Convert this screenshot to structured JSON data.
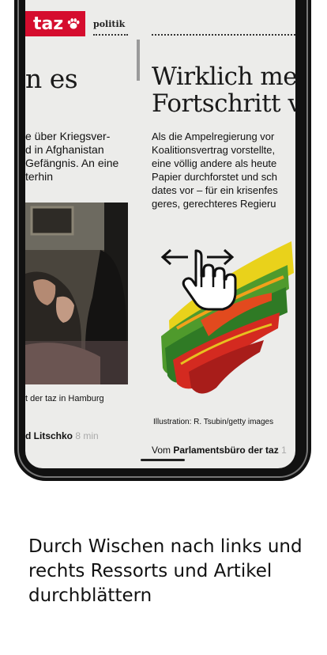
{
  "header": {
    "logo_text": "taz",
    "ressort": "politik",
    "brand_color": "#d50d2e"
  },
  "left_article": {
    "headline": "n es",
    "teaser_lines": [
      "e über Kriegsver-",
      "d in Afghanistan",
      "Gefängnis. An eine",
      "terhin"
    ],
    "photo_caption": "t der taz in Hamburg",
    "author_name": "d Litschko",
    "reading_time": "8 min"
  },
  "right_article": {
    "headline_lines": [
      "Wirklich me",
      "Fortschritt v"
    ],
    "teaser_lines": [
      "Als die Ampelregierung vor",
      "Koalitionsvertrag vorstellte,",
      "eine völlig andere als heute",
      "Papier durchforstet und sch",
      "dates vor – für ein krisenfes",
      "geres, gerechteres Regieru"
    ],
    "illustration_caption": "Illustration: R. Tsubin/getty images",
    "byline_prefix": "Vom",
    "byline_author": "Parlamentsbüro der taz",
    "byline_suffix": "1"
  },
  "gesture": {
    "icon": "swipe-hand-icon"
  },
  "onboarding": {
    "caption": "Durch Wischen nach links und rechts Ressorts und Artikel durchblättern"
  }
}
